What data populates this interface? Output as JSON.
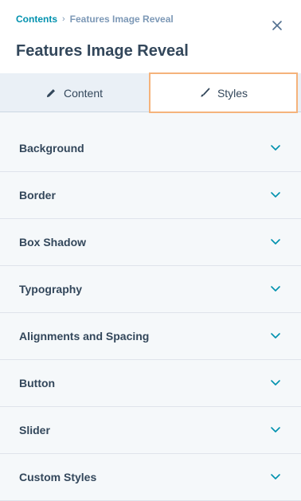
{
  "breadcrumb": {
    "parent": "Contents",
    "separator": "›",
    "current": "Features Image Reveal"
  },
  "header": {
    "title": "Features Image Reveal",
    "close_icon": "close-icon"
  },
  "tabs": [
    {
      "label": "Content",
      "icon": "pencil-icon",
      "active": false
    },
    {
      "label": "Styles",
      "icon": "brush-icon",
      "active": true
    }
  ],
  "sections": [
    {
      "label": "Background"
    },
    {
      "label": "Border"
    },
    {
      "label": "Box Shadow"
    },
    {
      "label": "Typography"
    },
    {
      "label": "Alignments and Spacing"
    },
    {
      "label": "Button"
    },
    {
      "label": "Slider"
    },
    {
      "label": "Custom Styles"
    }
  ],
  "colors": {
    "link": "#0091ae",
    "text": "#33475b",
    "muted": "#7c98b6",
    "active_tab_border": "#f5b37b"
  }
}
